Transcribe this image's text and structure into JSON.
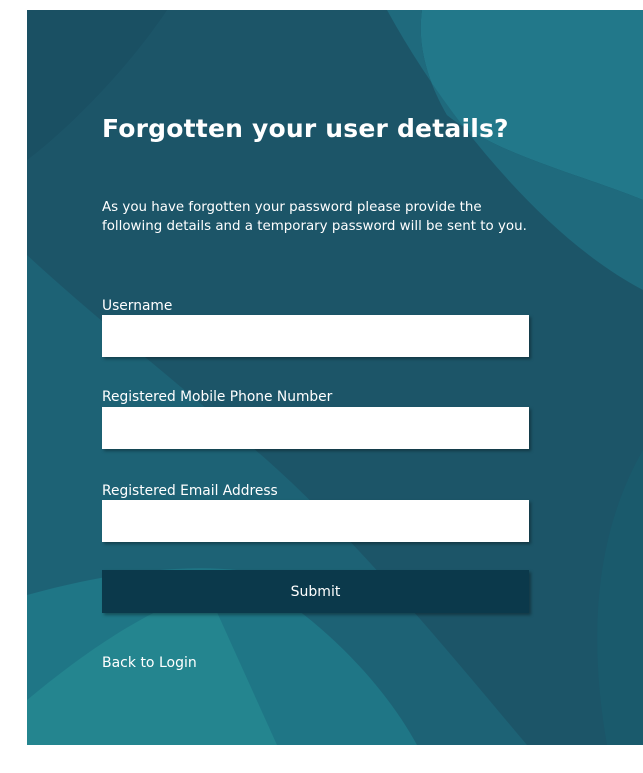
{
  "form": {
    "title": "Forgotten your user details?",
    "intro": "As you have forgotten your password please provide the following details and a temporary password will be sent to you.",
    "fields": [
      {
        "label": "Username",
        "value": ""
      },
      {
        "label": "Registered Mobile Phone Number",
        "value": ""
      },
      {
        "label": "Registered Email Address",
        "value": ""
      }
    ],
    "submit_label": "Submit",
    "back_link_label": "Back to Login"
  },
  "colors": {
    "panel_background": "#1c5568",
    "button_background": "#0b394b",
    "text": "#ffffff",
    "input_background": "#ffffff"
  }
}
